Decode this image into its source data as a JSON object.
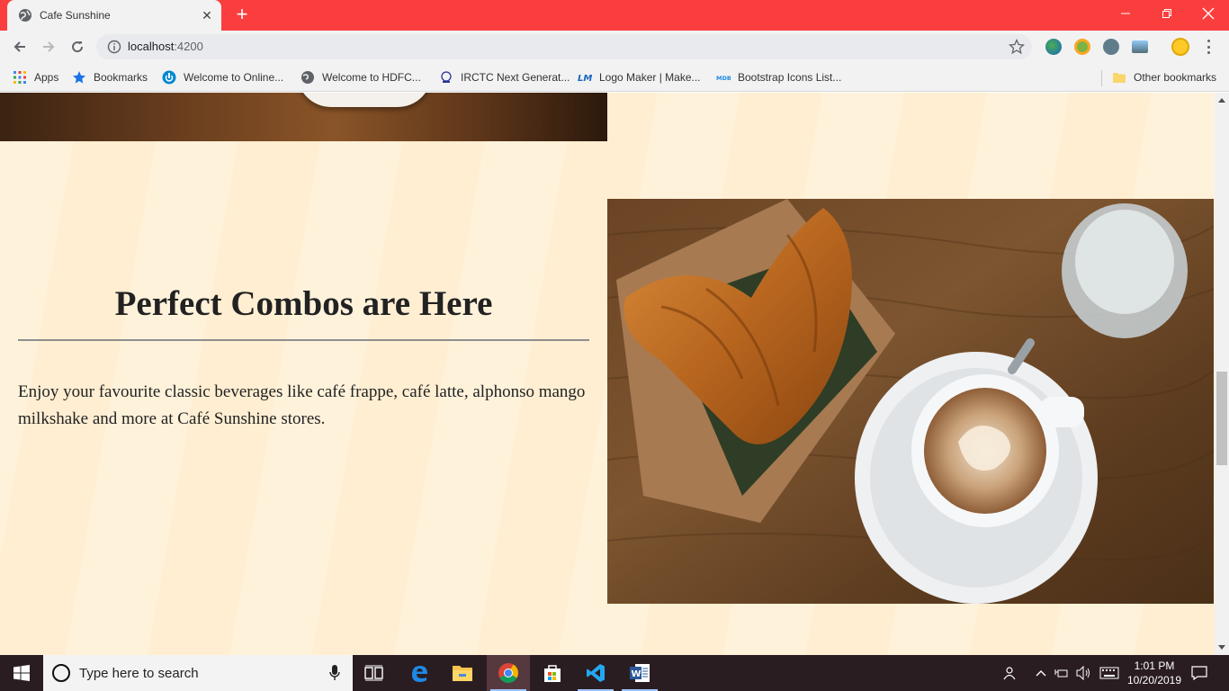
{
  "browser": {
    "tab_title": "Cafe Sunshine",
    "new_tab": "+",
    "url_host": "localhost",
    "url_port": ":4200",
    "colors": {
      "titlebar": "#fa3e3e",
      "toolbar": "#f2f2f2"
    }
  },
  "bookmarks": {
    "apps": "Apps",
    "items": [
      "Bookmarks",
      "Welcome to Online...",
      "Welcome to HDFC...",
      "IRCTC Next Generat...",
      "Logo Maker | Make...",
      "Bootstrap Icons List..."
    ],
    "other": "Other bookmarks"
  },
  "page": {
    "heading": "Perfect Combos are Here",
    "paragraph": "Enjoy your favourite classic beverages like café frappe, café latte, alphonso mango milkshake and more at Café Sunshine stores.",
    "background_color": "#fff0d6"
  },
  "taskbar": {
    "search_placeholder": "Type here to search",
    "time": "1:01 PM",
    "date": "10/20/2019"
  }
}
